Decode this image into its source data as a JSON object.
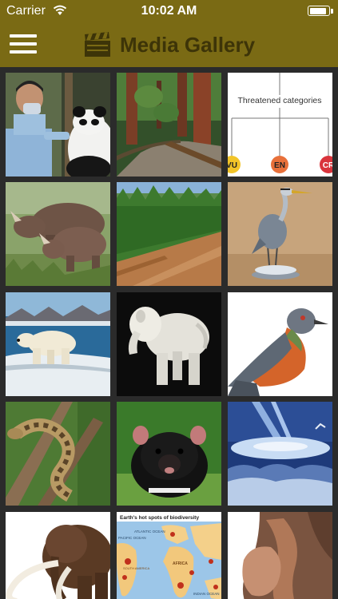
{
  "status_bar": {
    "carrier": "Carrier",
    "time": "10:02 AM",
    "battery_level": 0.95
  },
  "nav": {
    "title": "Media Gallery",
    "menu_icon": "hamburger-menu-icon",
    "title_icon": "clapperboard-icon"
  },
  "colors": {
    "bar_background": "#7a6a14",
    "title_text": "#3d3408",
    "gallery_background": "#2b2b2b"
  },
  "gallery": {
    "items": [
      {
        "id": "panda-doctor"
      },
      {
        "id": "redwood-forest-path"
      },
      {
        "id": "threatened-categories-diagram",
        "title": "Threatened categories",
        "labels": [
          "VU",
          "EN",
          "CR"
        ]
      },
      {
        "id": "rhinoceroses"
      },
      {
        "id": "deforested-hillside"
      },
      {
        "id": "grey-heron"
      },
      {
        "id": "polar-bear-on-ice"
      },
      {
        "id": "ivory-elephant-carving"
      },
      {
        "id": "passenger-pigeon"
      },
      {
        "id": "python-on-branch"
      },
      {
        "id": "tasmanian-devil"
      },
      {
        "id": "asteroid-impact"
      },
      {
        "id": "woolly-mammoth"
      },
      {
        "id": "biodiversity-hotspots-map",
        "title": "Earth's hot spots of biodiversity",
        "labels": [
          "ATLANTIC OCEAN",
          "PACIFIC OCEAN",
          "AFRICA",
          "INDIAN OCEAN",
          "SOUTH AMERICA"
        ]
      },
      {
        "id": "fossil-wood"
      }
    ]
  }
}
